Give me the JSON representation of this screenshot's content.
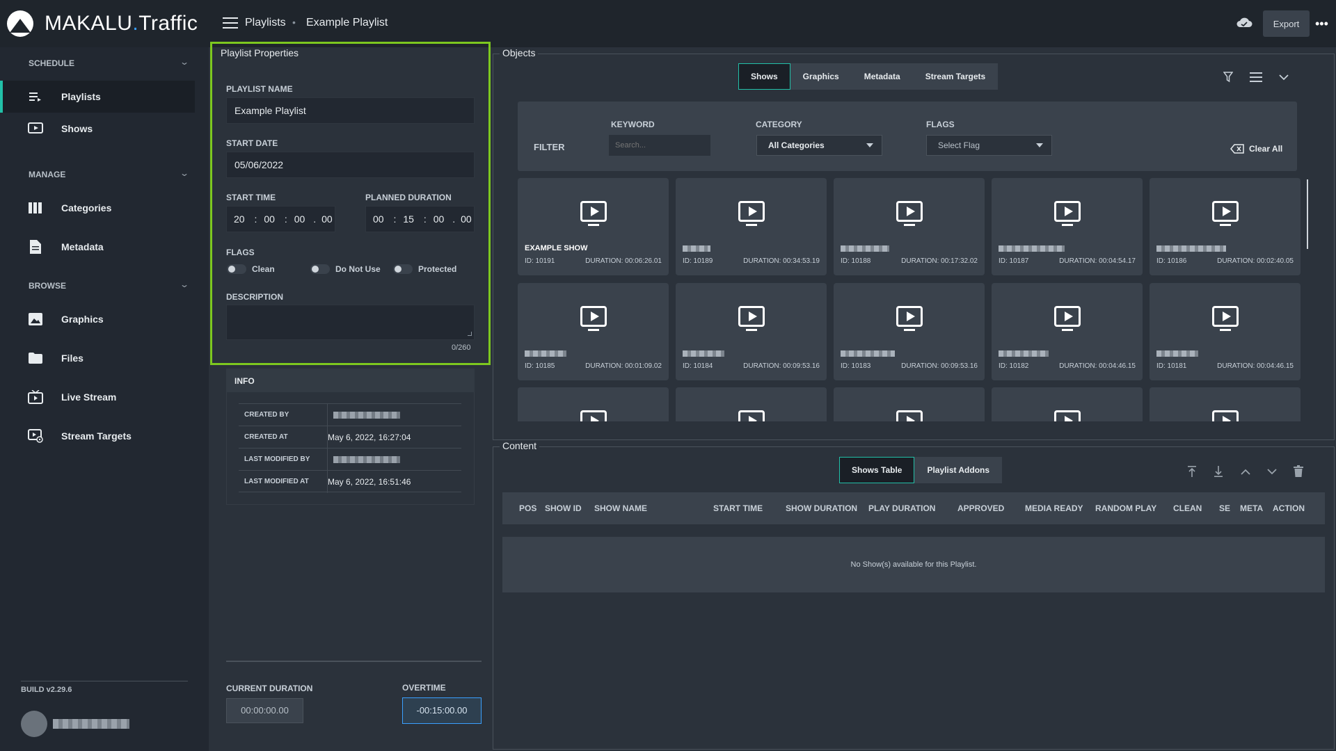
{
  "app": {
    "brand_a": "MAKALU",
    "brand_dot": ".",
    "brand_b": "Traffic",
    "build": "BUILD v2.29.6"
  },
  "breadcrumb": {
    "first": "Playlists",
    "second": "Example Playlist"
  },
  "toolbar": {
    "export": "Export"
  },
  "sidebar": {
    "schedule": "SCHEDULE",
    "manage": "MANAGE",
    "browse": "BROWSE",
    "items": [
      {
        "label": "Playlists",
        "icon": "playlist-icon"
      },
      {
        "label": "Shows",
        "icon": "play-icon"
      },
      {
        "label": "Categories",
        "icon": "columns-icon"
      },
      {
        "label": "Metadata",
        "icon": "document-icon"
      },
      {
        "label": "Graphics",
        "icon": "image-icon"
      },
      {
        "label": "Files",
        "icon": "folder-icon"
      },
      {
        "label": "Live Stream",
        "icon": "live-icon"
      },
      {
        "label": "Stream Targets",
        "icon": "target-icon"
      }
    ]
  },
  "props": {
    "title": "Playlist Properties",
    "name_label": "PLAYLIST NAME",
    "name_value": "Example Playlist",
    "date_label": "START DATE",
    "date_value": "05/06/2022",
    "time_label": "START TIME",
    "time": [
      "20",
      "00",
      "00",
      "00"
    ],
    "planned_label": "PLANNED DURATION",
    "planned": [
      "00",
      "15",
      "00",
      "00"
    ],
    "flags_label": "FLAGS",
    "flags": [
      "Clean",
      "Do Not Use",
      "Protected"
    ],
    "desc_label": "DESCRIPTION",
    "desc_count": "0/260"
  },
  "info": {
    "title": "INFO",
    "rows": [
      {
        "key": "CREATED BY",
        "value": ""
      },
      {
        "key": "CREATED AT",
        "value": "May 6, 2022, 16:27:04"
      },
      {
        "key": "LAST MODIFIED BY",
        "value": ""
      },
      {
        "key": "LAST MODIFIED AT",
        "value": "May 6, 2022, 16:51:46"
      }
    ]
  },
  "durations": {
    "current_label": "CURRENT DURATION",
    "current_value": "00:00:00.00",
    "overtime_label": "OVERTIME",
    "overtime_value": "-00:15:00.00"
  },
  "objects": {
    "title": "Objects",
    "tabs": [
      "Shows",
      "Graphics",
      "Metadata",
      "Stream Targets"
    ],
    "filter": {
      "label": "FILTER",
      "keyword_label": "KEYWORD",
      "keyword_placeholder": "Search...",
      "category_label": "CATEGORY",
      "category_value": "All Categories",
      "flags_label": "FLAGS",
      "flags_placeholder": "Select Flag",
      "clear": "Clear All"
    },
    "cards": [
      {
        "title": "EXAMPLE SHOW",
        "id": "ID: 10191",
        "duration": "DURATION: 00:06:26.01"
      },
      {
        "title": "",
        "id": "ID: 10189",
        "duration": "DURATION: 00:34:53.19"
      },
      {
        "title": "",
        "id": "ID: 10188",
        "duration": "DURATION: 00:17:32.02"
      },
      {
        "title": "",
        "id": "ID: 10187",
        "duration": "DURATION: 00:04:54.17"
      },
      {
        "title": "",
        "id": "ID: 10186",
        "duration": "DURATION: 00:02:40.05"
      },
      {
        "title": "",
        "id": "ID: 10185",
        "duration": "DURATION: 00:01:09.02"
      },
      {
        "title": "",
        "id": "ID: 10184",
        "duration": "DURATION: 00:09:53.16"
      },
      {
        "title": "",
        "id": "ID: 10183",
        "duration": "DURATION: 00:09:53.16"
      },
      {
        "title": "",
        "id": "ID: 10182",
        "duration": "DURATION: 00:04:46.15"
      },
      {
        "title": "",
        "id": "ID: 10181",
        "duration": "DURATION: 00:04:46.15"
      },
      {
        "title": "",
        "id": "",
        "duration": ""
      },
      {
        "title": "",
        "id": "",
        "duration": ""
      },
      {
        "title": "",
        "id": "",
        "duration": ""
      },
      {
        "title": "",
        "id": "",
        "duration": ""
      },
      {
        "title": "",
        "id": "",
        "duration": ""
      }
    ]
  },
  "content": {
    "title": "Content",
    "tabs": [
      "Shows Table",
      "Playlist Addons"
    ],
    "columns": [
      "POS",
      "SHOW ID",
      "SHOW NAME",
      "START TIME",
      "SHOW DURATION",
      "PLAY DURATION",
      "APPROVED",
      "MEDIA READY",
      "RANDOM PLAY",
      "CLEAN",
      "SE",
      "META",
      "ACTION"
    ],
    "empty": "No Show(s) available for this Playlist."
  }
}
